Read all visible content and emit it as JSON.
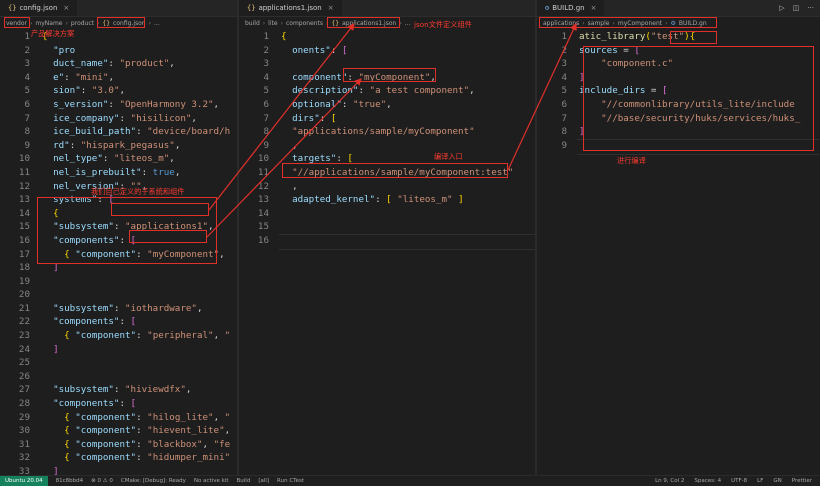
{
  "pane1": {
    "tab": {
      "icon": "{}",
      "name": "config.json"
    },
    "breadcrumb": [
      "vendor",
      "myName",
      "product",
      "config.json",
      "..."
    ],
    "lines": [
      {
        "n": "1",
        "html": "<span class='bk2'>{</span>"
      },
      {
        "n": "2",
        "html": "  <span class='k'>\"pro</span>"
      },
      {
        "n": "3",
        "html": "  <span class='k'>duct_name\"</span>: <span class='s'>\"product\"</span>,"
      },
      {
        "n": "4",
        "html": "  <span class='k'>e\"</span>: <span class='s'>\"mini\"</span>,"
      },
      {
        "n": "5",
        "html": "  <span class='k'>sion\"</span>: <span class='s'>\"3.0\"</span>,"
      },
      {
        "n": "6",
        "html": "  <span class='k'>s_version\"</span>: <span class='s'>\"OpenHarmony 3.2\"</span>,"
      },
      {
        "n": "7",
        "html": "  <span class='k'>ice_company\"</span>: <span class='s'>\"hisilicon\"</span>,"
      },
      {
        "n": "8",
        "html": "  <span class='k'>ice_build_path\"</span>: <span class='s'>\"device/board/h</span>"
      },
      {
        "n": "9",
        "html": "  <span class='k'>rd\"</span>: <span class='s'>\"hispark_pegasus\"</span>,"
      },
      {
        "n": "10",
        "html": "  <span class='k'>nel_type\"</span>: <span class='s'>\"liteos_m\"</span>,"
      },
      {
        "n": "11",
        "html": "  <span class='k'>nel_is_prebuilt\"</span>: <span class='lit'>true</span>,"
      },
      {
        "n": "12",
        "html": "  <span class='k'>nel_version\"</span>: <span class='s'>\"\"</span>,"
      },
      {
        "n": "13",
        "html": "  <span class='k'>systems\"</span>: <span class='bk'>[</span>"
      },
      {
        "n": "14",
        "html": "  <span class='bk2'>{</span>"
      },
      {
        "n": "15",
        "html": "  <span class='k'>\"subsystem\"</span>: <span class='s'>\"applications1\"</span>,"
      },
      {
        "n": "16",
        "html": "  <span class='k'>\"components\"</span>: <span class='bk'>[</span>"
      },
      {
        "n": "17",
        "html": "    <span class='bk2'>{</span> <span class='k'>\"component\"</span>: <span class='s'>\"myComponent\"</span>,"
      },
      {
        "n": "18",
        "html": "  <span class='bk'>]</span>"
      },
      {
        "n": "19",
        "html": ""
      },
      {
        "n": "20",
        "html": ""
      },
      {
        "n": "21",
        "html": "  <span class='k'>\"subsystem\"</span>: <span class='s'>\"iothardware\"</span>,"
      },
      {
        "n": "22",
        "html": "  <span class='k'>\"components\"</span>: <span class='bk'>[</span>"
      },
      {
        "n": "23",
        "html": "    <span class='bk2'>{</span> <span class='k'>\"component\"</span>: <span class='s'>\"peripheral\"</span>, <span class='s'>\"</span>"
      },
      {
        "n": "24",
        "html": "  <span class='bk'>]</span>"
      },
      {
        "n": "25",
        "html": ""
      },
      {
        "n": "26",
        "html": ""
      },
      {
        "n": "27",
        "html": "  <span class='k'>\"subsystem\"</span>: <span class='s'>\"hiviewdfx\"</span>,"
      },
      {
        "n": "28",
        "html": "  <span class='k'>\"components\"</span>: <span class='bk'>[</span>"
      },
      {
        "n": "29",
        "html": "    <span class='bk2'>{</span> <span class='k'>\"component\"</span>: <span class='s'>\"hilog_lite\"</span>, <span class='s'>\"</span>"
      },
      {
        "n": "30",
        "html": "    <span class='bk2'>{</span> <span class='k'>\"component\"</span>: <span class='s'>\"hievent_lite\"</span>,"
      },
      {
        "n": "31",
        "html": "    <span class='bk2'>{</span> <span class='k'>\"component\"</span>: <span class='s'>\"blackbox\"</span>, <span class='s'>\"fe</span>"
      },
      {
        "n": "32",
        "html": "    <span class='bk2'>{</span> <span class='k'>\"component\"</span>: <span class='s'>\"hidumper_mini\"</span>"
      },
      {
        "n": "33",
        "html": "  <span class='bk'>]</span>"
      }
    ]
  },
  "pane2": {
    "tab": {
      "icon": "{}",
      "name": "applications1.json"
    },
    "breadcrumb": [
      "build",
      "lite",
      "components",
      "applications1.json",
      "..."
    ],
    "lines": [
      {
        "n": "1",
        "html": "<span class='bk2'>{</span>"
      },
      {
        "n": "2",
        "html": "  <span class='k'>onents\"</span>: <span class='bk'>[</span>"
      },
      {
        "n": "3",
        "html": ""
      },
      {
        "n": "4",
        "html": "  <span class='k'>component\"</span>: <span class='s'>\"myComponent\"</span>,"
      },
      {
        "n": "5",
        "html": "  <span class='k'>description\"</span>: <span class='s'>\"a test component\"</span>,"
      },
      {
        "n": "6",
        "html": "  <span class='k'>optional\"</span>: <span class='s'>\"true\"</span>,"
      },
      {
        "n": "7",
        "html": "  <span class='k'>dirs\"</span>: <span class='bk2'>[</span>"
      },
      {
        "n": "8",
        "html": "  <span class='s'>\"applications/sample/myComponent\"</span>"
      },
      {
        "n": "9",
        "html": "  ,"
      },
      {
        "n": "10",
        "html": "  <span class='k'>targets\"</span>: <span class='bk2'>[</span>"
      },
      {
        "n": "11",
        "html": "  <span class='s'>\"//applications/sample/myComponent:test\"</span>"
      },
      {
        "n": "12",
        "html": "  ,"
      },
      {
        "n": "13",
        "html": "  <span class='k'>adapted_kernel\"</span>: <span class='bk2'>[</span> <span class='s'>\"liteos_m\"</span> <span class='bk2'>]</span>"
      },
      {
        "n": "14",
        "html": ""
      },
      {
        "n": "15",
        "html": ""
      },
      {
        "n": "16",
        "html": ""
      }
    ]
  },
  "pane3": {
    "tab": {
      "icon": "⚙",
      "name": "BUILD.gn"
    },
    "breadcrumb": [
      "applications",
      "sample",
      "myComponent",
      "BUILD.gn"
    ],
    "lines": [
      {
        "n": "1",
        "html": "<span class='fn'>atic_library</span><span class='bk2'>(</span><span class='s'>\"test\"</span><span class='bk2'>)</span><span class='bk2'>{</span>"
      },
      {
        "n": "2",
        "html": "<span class='k'>sources</span> = <span class='bk'>[</span>"
      },
      {
        "n": "3",
        "html": "    <span class='s'>\"component.c\"</span>"
      },
      {
        "n": "4",
        "html": "<span class='bk'>]</span>"
      },
      {
        "n": "5",
        "html": "<span class='k'>include_dirs</span> = <span class='bk'>[</span>"
      },
      {
        "n": "6",
        "html": "    <span class='s'>\"//commonlibrary/utils_lite/include</span>"
      },
      {
        "n": "7",
        "html": "    <span class='s'>\"//base/security/huks/services/huks_</span>"
      },
      {
        "n": "8",
        "html": "<span class='bk'>]</span>"
      },
      {
        "n": "9",
        "html": ""
      }
    ]
  },
  "annotations": {
    "product_solution": "产品解决方案",
    "own_subsystem": "我们自己定义的子系统和组件",
    "json_component": "json文件定义组件",
    "compile_entry": "编译入口",
    "do_compile": "进行编译"
  },
  "toolbar_icons": [
    "run-icon",
    "split-editor-icon",
    "more-icon"
  ],
  "status": {
    "remote": "Ubuntu 20.04",
    "branch": "81c8bbd4",
    "errors": "⊗ 0 ⚠ 0",
    "cmake": "CMake: [Debug]: Ready",
    "kit": "No active kit",
    "build": "Build",
    "all": "[all]",
    "run_ctest": "Run CTest",
    "position": "Ln 9, Col 2",
    "spaces": "Spaces: 4",
    "encoding": "UTF-8",
    "eol": "LF",
    "lang": "GN",
    "prettier": "Prettier"
  },
  "colors": {
    "annotation": "#e0302a",
    "background": "#1e1e1e",
    "statusbar": "#1f1f1f"
  }
}
